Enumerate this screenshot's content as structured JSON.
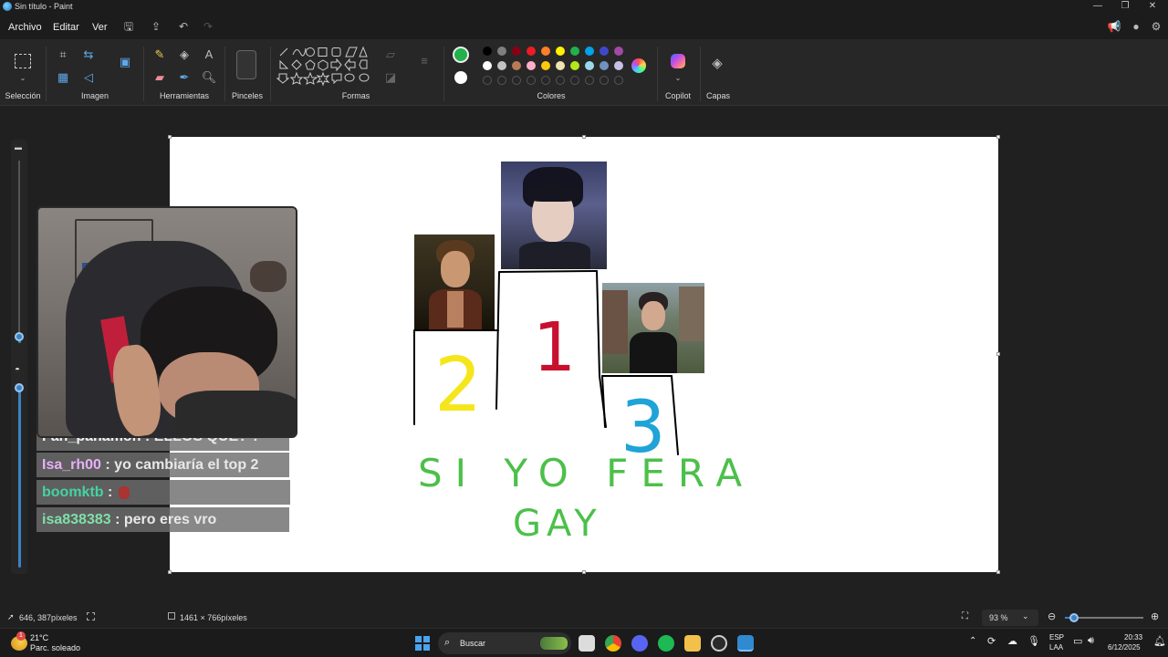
{
  "window": {
    "title": "Sin título - Paint",
    "minimize": "—",
    "maximize": "❐",
    "close": "✕"
  },
  "menu": {
    "file": "Archivo",
    "edit": "Editar",
    "view": "Ver"
  },
  "ribbon": {
    "groups": {
      "selection": "Selección",
      "image": "Imagen",
      "tools": "Herramientas",
      "brushes": "Pinceles",
      "shapes": "Formas",
      "colors": "Colores",
      "copilot": "Copilot",
      "layers": "Capas"
    },
    "palette_row1": [
      "#000000",
      "#7f7f7f",
      "#880015",
      "#ed1c24",
      "#ff7f27",
      "#fff200",
      "#22b14c",
      "#00a2e8",
      "#3f48cc",
      "#a349a4"
    ],
    "palette_row2": [
      "#ffffff",
      "#c3c3c3",
      "#b97a57",
      "#ffaec9",
      "#ffc90e",
      "#efe4b0",
      "#b5e61d",
      "#99d9ea",
      "#7092be",
      "#c8bfe7"
    ],
    "primary_color": "#22b14c",
    "secondary_color": "#ffffff"
  },
  "canvas_drawing": {
    "rank1": "1",
    "rank2": "2",
    "rank3": "3",
    "line1": "SI YO FERA",
    "line2": "GAY",
    "rank1_color": "#c8102e",
    "rank2_color": "#f5e61c",
    "rank3_color": "#1fa3d8",
    "text_color": "#4cc04a"
  },
  "chat": [
    {
      "user": "Fan_panamon",
      "message": ": ELLOS QUE? ?",
      "user_color": "#f2f2f2"
    },
    {
      "user": "Isa_rh00",
      "message": ": yo cambiaría el top 2",
      "user_color": "#e6b0f5"
    },
    {
      "user": "boomktb",
      "message": ":",
      "user_color": "#43d3a3"
    },
    {
      "user": "isa838383",
      "message": ": pero eres vro",
      "user_color": "#7fe0a8"
    }
  ],
  "status": {
    "cursor_pos": "646, 387píxeles",
    "canvas_size": "1461 × 766píxeles",
    "zoom": "93 %",
    "zoom_fraction": 0.12
  },
  "taskbar": {
    "weather_temp": "21°C",
    "weather_desc": "Parc. soleado",
    "search_placeholder": "Buscar",
    "lang1": "ESP",
    "lang2": "LAA",
    "time": "20:33",
    "date": "6/12/2025",
    "notif_badge": "1"
  }
}
